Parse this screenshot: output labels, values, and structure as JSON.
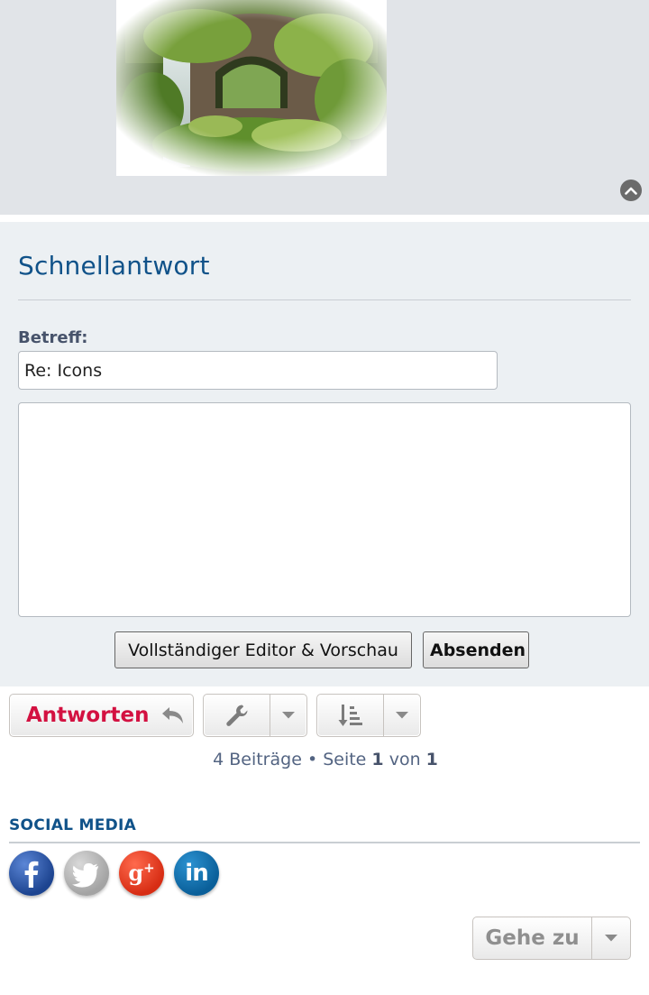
{
  "quickreply": {
    "title": "Schnellantwort",
    "subject_label": "Betreff:",
    "subject_value": "Re: Icons",
    "message_value": "",
    "full_editor_label": "Vollständiger Editor & Vorschau",
    "submit_label": "Absenden"
  },
  "actions": {
    "reply_label": "Antworten"
  },
  "pagination": {
    "count_text": "4 Beiträge",
    "separator": "•",
    "page_word": "Seite",
    "current_page": "1",
    "of_word": "von",
    "total_pages": "1"
  },
  "social": {
    "title": "SOCIAL MEDIA",
    "icons": [
      "facebook-icon",
      "twitter-icon",
      "google-plus-icon",
      "linkedin-icon"
    ]
  },
  "jumpbox": {
    "label": "Gehe zu"
  },
  "colors": {
    "accent": "#105289",
    "reply": "#d31141",
    "panel": "#ecf0f3",
    "post_bg": "#e1e4e8"
  }
}
